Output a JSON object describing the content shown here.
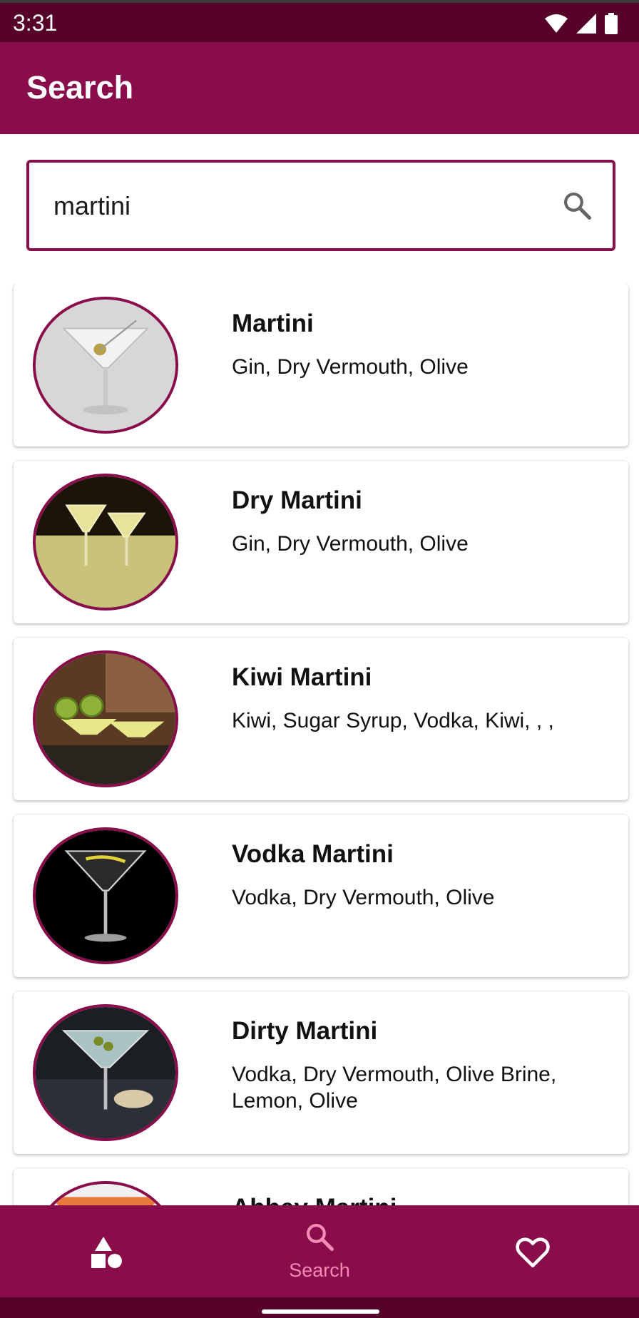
{
  "status_bar": {
    "time": "3:31",
    "icons": [
      "wifi-icon",
      "signal-icon",
      "battery-icon"
    ]
  },
  "app_bar": {
    "title": "Search"
  },
  "search": {
    "value": "martini",
    "icon": "search-icon"
  },
  "results": [
    {
      "name": "Martini",
      "ingredients": "Gin, Dry Vermouth, Olive"
    },
    {
      "name": "Dry Martini",
      "ingredients": "Gin, Dry Vermouth, Olive"
    },
    {
      "name": "Kiwi Martini",
      "ingredients": "Kiwi, Sugar Syrup, Vodka, Kiwi, , ,"
    },
    {
      "name": "Vodka Martini",
      "ingredients": "Vodka, Dry Vermouth, Olive"
    },
    {
      "name": "Dirty Martini",
      "ingredients": "Vodka, Dry Vermouth, Olive Brine, Lemon, Olive"
    },
    {
      "name": "Abbey Martini",
      "ingredients": ""
    }
  ],
  "bottom_nav": {
    "items": [
      {
        "icon": "categories-icon",
        "label": ""
      },
      {
        "icon": "search-icon",
        "label": "Search",
        "active": true
      },
      {
        "icon": "heart-icon",
        "label": ""
      }
    ]
  },
  "colors": {
    "primary": "#880d4a",
    "primary_dark": "#560128",
    "accent": "#f58ab5"
  }
}
